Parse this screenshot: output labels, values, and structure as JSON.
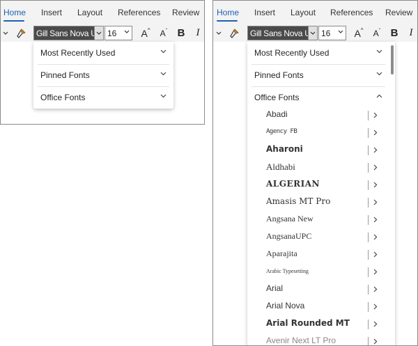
{
  "ribbon": {
    "tabs": [
      "Home",
      "Insert",
      "Layout",
      "References",
      "Review"
    ],
    "active_tab": "Home",
    "accent_color": "#1f5fb3"
  },
  "toolbar": {
    "font_name": "Gill Sans Nova UI",
    "font_size": "16",
    "grow_font_label": "A",
    "shrink_font_label": "A",
    "bold_label": "B",
    "italic_label": "I"
  },
  "left_dropdown": {
    "sections": [
      "Most Recently Used",
      "Pinned Fonts",
      "Office Fonts"
    ]
  },
  "right_dropdown": {
    "sections": [
      "Most Recently Used",
      "Pinned Fonts",
      "Office Fonts"
    ],
    "office_fonts": [
      "Abadi",
      "Agency FB",
      "Aharoni",
      "Aldhabi",
      "ALGERIAN",
      "Amasis MT Pro",
      "Angsana New",
      "AngsanaUPC",
      "Aparajita",
      "Arabic Typesetting",
      "Arial",
      "Arial Nova",
      "Arial Rounded MT",
      "Avenir Next LT Pro"
    ]
  }
}
